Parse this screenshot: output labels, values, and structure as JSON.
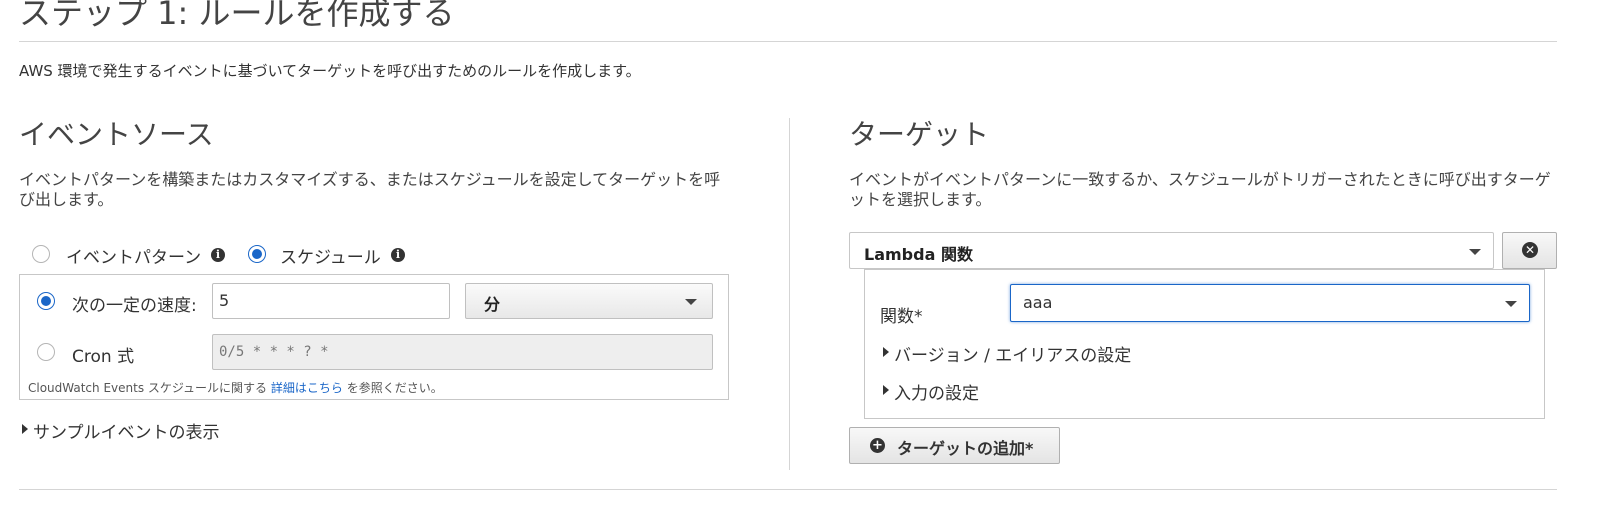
{
  "page": {
    "title": "ステップ 1: ルールを作成する",
    "description": "AWS 環境で発生するイベントに基づいてターゲットを呼び出すためのルールを作成します。"
  },
  "event_source": {
    "heading": "イベントソース",
    "description": "イベントパターンを構築またはカスタマイズする、またはスケジュールを設定してターゲットを呼び出します。",
    "mode_options": [
      {
        "label": "イベントパターン",
        "checked": false,
        "icon": "info-icon"
      },
      {
        "label": "スケジュール",
        "checked": true,
        "icon": "info-icon"
      }
    ],
    "schedule": {
      "rate_label": "次の一定の速度:",
      "rate_value": "5",
      "unit_value": "分",
      "cron_label": "Cron 式",
      "cron_placeholder": "0/5 * * * ? *",
      "help_prefix": "CloudWatch Events スケジュールに関する",
      "help_link": "詳細はこちら",
      "help_suffix": "を参照ください。"
    },
    "sample_toggle": "サンプルイベントの表示"
  },
  "targets": {
    "heading": "ターゲット",
    "description": "イベントがイベントパターンに一致するか、スケジュールがトリガーされたときに呼び出すターゲットを選択します。",
    "target_type": "Lambda 関数",
    "function_label": "関数*",
    "function_value": "aaa",
    "version_toggle": "バージョン / エイリアスの設定",
    "input_toggle": "入力の設定",
    "add_target_label": "ターゲットの追加*"
  },
  "colors": {
    "accent": "#1a66c8",
    "border": "#c7c7c7"
  }
}
